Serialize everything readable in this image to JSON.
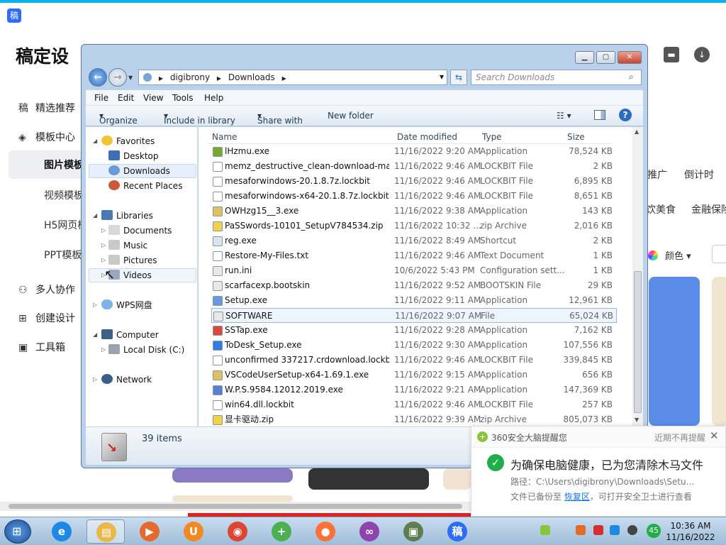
{
  "background": {
    "app_logo": "稿",
    "title": "稿定设",
    "nav": [
      {
        "label": "精选推荐",
        "icon": "logo-icon"
      },
      {
        "label": "模板中心",
        "icon": "layers-icon"
      }
    ],
    "subnav": [
      "图片模板",
      "视频模板",
      "H5网页模",
      "PPT模板"
    ],
    "nav2": [
      {
        "label": "多人协作",
        "icon": "users-icon"
      },
      {
        "label": "创建设计",
        "icon": "plus-square-icon"
      },
      {
        "label": "工具箱",
        "icon": "toolbox-icon"
      }
    ],
    "right_tags": [
      "推广",
      "倒计时",
      "饮美食",
      "金融保险"
    ],
    "color_label": "颜色"
  },
  "explorer": {
    "breadcrumb": [
      "digibrony",
      "Downloads"
    ],
    "search_placeholder": "Search Downloads",
    "menu": [
      "File",
      "Edit",
      "View",
      "Tools",
      "Help"
    ],
    "commands": [
      "Organize",
      "Include in library",
      "Share with",
      "New folder"
    ],
    "nav": {
      "favorites": "Favorites",
      "desktop": "Desktop",
      "downloads": "Downloads",
      "recent": "Recent Places",
      "libraries": "Libraries",
      "documents": "Documents",
      "music": "Music",
      "pictures": "Pictures",
      "videos": "Videos",
      "wps": "WPS网盘",
      "computer": "Computer",
      "localdisk": "Local Disk (C:)",
      "network": "Network"
    },
    "columns": {
      "name": "Name",
      "date": "Date modified",
      "type": "Type",
      "size": "Size"
    },
    "files": [
      {
        "name": "lHzmu.exe",
        "date": "11/16/2022 9:20 AM",
        "type": "Application",
        "size": "78,524 KB",
        "icon": "#7aa82c"
      },
      {
        "name": "memz_destructive_clean-download-mai...",
        "date": "11/16/2022 9:46 AM",
        "type": "LOCKBIT File",
        "size": "2 KB",
        "icon": "#ffffff"
      },
      {
        "name": "mesaforwindows-20.1.8.7z.lockbit",
        "date": "11/16/2022 9:46 AM",
        "type": "LOCKBIT File",
        "size": "6,895 KB",
        "icon": "#ffffff"
      },
      {
        "name": "mesaforwindows-x64-20.1.8.7z.lockbit",
        "date": "11/16/2022 9:46 AM",
        "type": "LOCKBIT File",
        "size": "8,651 KB",
        "icon": "#ffffff"
      },
      {
        "name": "OWHzg15__3.exe",
        "date": "11/16/2022 9:38 AM",
        "type": "Application",
        "size": "143 KB",
        "icon": "#e0c060"
      },
      {
        "name": "PaSSwords-10101_SetupV784534.zip",
        "date": "11/16/2022 10:32 ...",
        "type": "zip Archive",
        "size": "2,016 KB",
        "icon": "#f3d24a"
      },
      {
        "name": "reg.exe",
        "date": "11/16/2022 8:49 AM",
        "type": "Shortcut",
        "size": "2 KB",
        "icon": "#d9e4f0"
      },
      {
        "name": "Restore-My-Files.txt",
        "date": "11/16/2022 9:46 AM",
        "type": "Text Document",
        "size": "1 KB",
        "icon": "#ffffff"
      },
      {
        "name": "run.ini",
        "date": "10/6/2022 5:43 PM",
        "type": "Configuration sett...",
        "size": "1 KB",
        "icon": "#e8e8e8"
      },
      {
        "name": "scarfacexp.bootskin",
        "date": "11/16/2022 9:52 AM",
        "type": "BOOTSKIN File",
        "size": "29 KB",
        "icon": "#e8e8e8"
      },
      {
        "name": "Setup.exe",
        "date": "11/16/2022 9:11 AM",
        "type": "Application",
        "size": "12,961 KB",
        "icon": "#6a9bd8"
      },
      {
        "name": "SOFTWARE",
        "date": "11/16/2022 9:07 AM",
        "type": "File",
        "size": "65,024 KB",
        "icon": "#e8e8e8"
      },
      {
        "name": "SSTap.exe",
        "date": "11/16/2022 9:28 AM",
        "type": "Application",
        "size": "7,162 KB",
        "icon": "#d84a3a"
      },
      {
        "name": "ToDesk_Setup.exe",
        "date": "11/16/2022 9:30 AM",
        "type": "Application",
        "size": "107,556 KB",
        "icon": "#2f7de1"
      },
      {
        "name": "unconfirmed 337217.crdownload.lockbit",
        "date": "11/16/2022 9:46 AM",
        "type": "LOCKBIT File",
        "size": "339,845 KB",
        "icon": "#ffffff"
      },
      {
        "name": "VSCodeUserSetup-x64-1.69.1.exe",
        "date": "11/16/2022 9:15 AM",
        "type": "Application",
        "size": "656 KB",
        "icon": "#e0c060"
      },
      {
        "name": "W.P.S.9584.12012.2019.exe",
        "date": "11/16/2022 9:21 AM",
        "type": "Application",
        "size": "147,369 KB",
        "icon": "#5a7fd0"
      },
      {
        "name": "win64.dll.lockbit",
        "date": "11/16/2022 9:46 AM",
        "type": "LOCKBIT File",
        "size": "257 KB",
        "icon": "#ffffff"
      },
      {
        "name": "显卡驱动.zip",
        "date": "11/16/2022 9:39 AM",
        "type": "zip Archive",
        "size": "805,073 KB",
        "icon": "#f3d24a"
      }
    ],
    "selected_file": "SOFTWARE",
    "item_count": "39 items"
  },
  "notification": {
    "app": "360安全大脑提醒您",
    "dismiss": "近期不再提醒",
    "headline": "为确保电脑健康，已为您清除木马文件",
    "path_label": "路径：",
    "path": "C:\\Users\\digibrony\\Downloads\\Setu...",
    "backup_prefix": "文件已备份至 ",
    "restore_link": "恢复区",
    "backup_suffix": "，可打开安全卫士进行查看"
  },
  "taskbar": {
    "apps": [
      {
        "name": "internet-explorer",
        "color": "#1e88e5",
        "glyph": "e"
      },
      {
        "name": "file-explorer",
        "color": "#e8b84a",
        "glyph": "▤"
      },
      {
        "name": "video-player",
        "color": "#e26a2c",
        "glyph": "▶"
      },
      {
        "name": "uc-browser",
        "color": "#f08a24",
        "glyph": "U"
      },
      {
        "name": "chrome",
        "color": "#dd4433",
        "glyph": "◉"
      },
      {
        "name": "360-security",
        "color": "#4caf50",
        "glyph": "+"
      },
      {
        "name": "firefox",
        "color": "#ff7139",
        "glyph": "●"
      },
      {
        "name": "mask-app",
        "color": "#8e44ad",
        "glyph": "∞"
      },
      {
        "name": "document-app",
        "color": "#5f7d4f",
        "glyph": "▣"
      },
      {
        "name": "gaoding",
        "color": "#2f6cf5",
        "glyph": "稿"
      }
    ],
    "tray_badge": "45",
    "time": "10:36 AM",
    "date": "11/16/2022"
  }
}
